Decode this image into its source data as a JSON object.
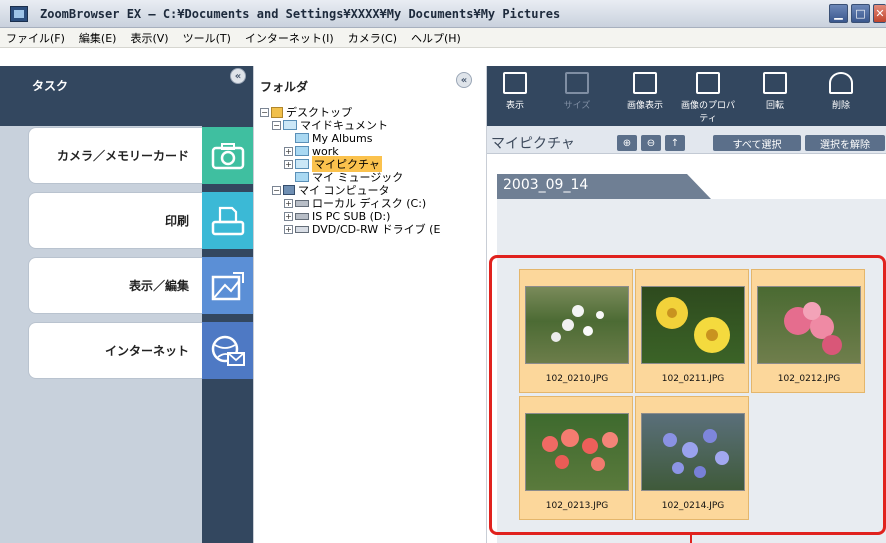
{
  "window": {
    "title": "ZoomBrowser EX  –  C:¥Documents and Settings¥XXXX¥My Documents¥My Pictures",
    "icon": "app-icon"
  },
  "menu": [
    "ファイル(F)",
    "編集(E)",
    "表示(V)",
    "ツール(T)",
    "インターネット(I)",
    "カメラ(C)",
    "ヘルプ(H)"
  ],
  "task_panel": {
    "title": "タスク",
    "items": [
      {
        "label": "カメラ／メモリーカード",
        "icon": "camera-icon",
        "color": "#3fbfa0"
      },
      {
        "label": "印刷",
        "icon": "printer-icon",
        "color": "#3bb9d6"
      },
      {
        "label": "表示／編集",
        "icon": "edit-icon",
        "color": "#5b8fd6"
      },
      {
        "label": "インターネット",
        "icon": "globe-mail-icon",
        "color": "#4e79c4"
      }
    ]
  },
  "folder_panel": {
    "title": "フォルダ",
    "tree": [
      {
        "label": "デスクトップ",
        "expander": "−"
      },
      {
        "label": "マイドキュメント",
        "expander": "−"
      },
      {
        "label": "My Albums",
        "expander": ""
      },
      {
        "label": "work",
        "expander": "+"
      },
      {
        "label": "マイピクチャ",
        "expander": "+",
        "selected": true
      },
      {
        "label": "マイ ミュージック",
        "expander": ""
      },
      {
        "label": "マイ コンピュータ",
        "expander": "−"
      },
      {
        "label": "ローカル ディスク (C:)",
        "expander": "+"
      },
      {
        "label": "IS PC SUB (D:)",
        "expander": "+"
      },
      {
        "label": "DVD/CD-RW ドライブ (E",
        "expander": "+"
      }
    ]
  },
  "viewer": {
    "toolbar": [
      {
        "label": "表示",
        "disabled": false
      },
      {
        "label": "サイズ",
        "disabled": true
      },
      {
        "label": "画像表示",
        "disabled": false
      },
      {
        "label": "画像のプロパティ",
        "disabled": false
      },
      {
        "label": "回転",
        "disabled": false
      },
      {
        "label": "削除",
        "disabled": false
      }
    ],
    "path": "マイピクチャ",
    "select_all": "すべて選択",
    "deselect": "選択を解除",
    "group_date": "2003_09_14",
    "thumbnails": [
      {
        "file": "102_0210.JPG"
      },
      {
        "file": "102_0211.JPG"
      },
      {
        "file": "102_0212.JPG"
      },
      {
        "file": "102_0213.JPG"
      },
      {
        "file": "102_0214.JPG"
      }
    ]
  },
  "colors": {
    "highlight": "#e0221e",
    "thumb_bg": "#fcd79b",
    "panel_dark": "#33475f"
  }
}
